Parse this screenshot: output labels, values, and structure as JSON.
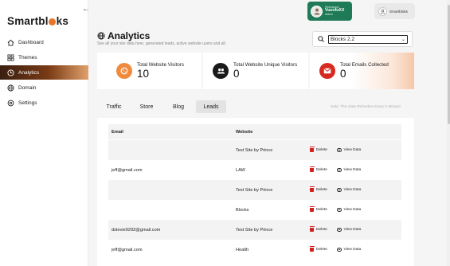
{
  "app": {
    "logo_prefix": "Smartbl",
    "logo_suffix": "ks"
  },
  "sidebar": {
    "items": [
      {
        "label": "Dashboard",
        "icon": "home-icon"
      },
      {
        "label": "Themes",
        "icon": "grid-icon"
      },
      {
        "label": "Analytics",
        "icon": "clock-icon",
        "active": true
      },
      {
        "label": "Domain",
        "icon": "globe-icon"
      },
      {
        "label": "Settings",
        "icon": "gear-icon"
      }
    ]
  },
  "topbar": {
    "user": {
      "line1": "Workspace",
      "name": "VusufuXX",
      "role": "Admin"
    },
    "store": {
      "label": "Smartbloks"
    }
  },
  "header": {
    "title": "Analytics",
    "subtitle": "See all your site data here, generated leads, active website users and all.",
    "site_select": "Blocks 2.2"
  },
  "stats": [
    {
      "label": "Total Website Visitors",
      "value": "10",
      "color": "#f08a3c"
    },
    {
      "label": "Total Website Unique Visitors",
      "value": "0",
      "color": "#1a1a1a"
    },
    {
      "label": "Total Emails Collected",
      "value": "0",
      "color": "#d62a20"
    }
  ],
  "tabs": [
    {
      "label": "Traffic"
    },
    {
      "label": "Store"
    },
    {
      "label": "Blog"
    },
    {
      "label": "Leads",
      "active": true
    }
  ],
  "refresh_note": "Note: This Data Refreshes Every 5 Minutes",
  "table": {
    "headers": {
      "email": "Email",
      "website": "Website"
    },
    "delete_label": "Delete",
    "view_label": "View Data",
    "rows": [
      {
        "email": "",
        "website": "Test Site by Prince"
      },
      {
        "email": "jeff@gmail.com",
        "website": "LAW"
      },
      {
        "email": "",
        "website": "Test Site by Prince"
      },
      {
        "email": "",
        "website": "Blocks"
      },
      {
        "email": "dstevie9292@gmail.com",
        "website": "Test Site by Prince"
      },
      {
        "email": "jeff@gmail.com",
        "website": "Health"
      }
    ]
  },
  "colors": {
    "active_nav_start": "#3b1f10",
    "active_nav_end": "#e1a16b",
    "user_card": "#1e7a57",
    "delete": "#d21f1f"
  }
}
